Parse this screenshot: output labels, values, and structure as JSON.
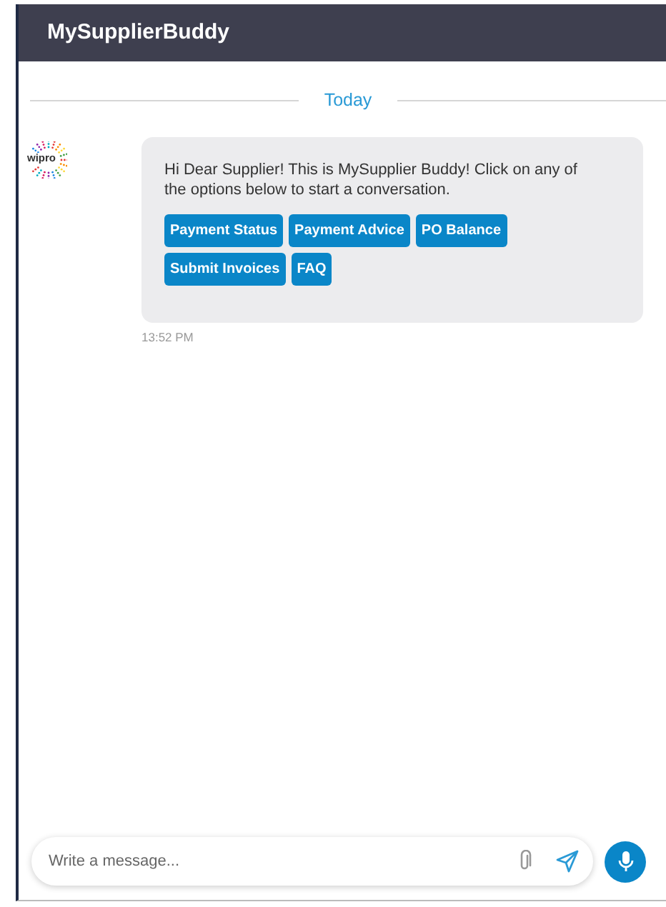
{
  "header": {
    "title": "MySupplierBuddy"
  },
  "date_divider": "Today",
  "messages": [
    {
      "avatar_text": "wipro",
      "text": "Hi Dear Supplier! This is MySupplier Buddy! Click on any of the options below to start a conversation.",
      "options": [
        "Payment Status",
        "Payment Advice",
        "PO Balance",
        "Submit Invoices",
        "FAQ"
      ],
      "time": "13:52 PM"
    }
  ],
  "composer": {
    "placeholder": "Write a message..."
  }
}
